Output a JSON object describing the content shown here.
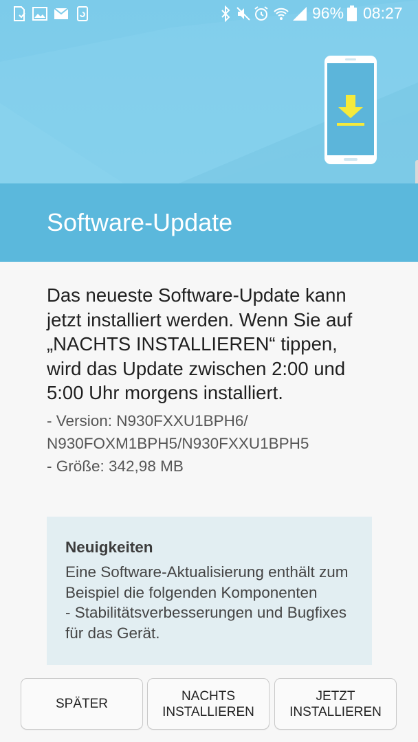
{
  "status_bar": {
    "left_icons": [
      "sim-card-icon",
      "gallery-icon",
      "email-icon",
      "recycle-icon"
    ],
    "right_icons": [
      "bluetooth-icon",
      "mute-icon",
      "alarm-icon",
      "wifi-icon",
      "signal-icon",
      "battery-icon"
    ],
    "battery_percent": "96%",
    "time": "08:27"
  },
  "header": {
    "illustration": "phone-download-icon",
    "accent_color": "#f5ea3b",
    "band_color": "#5bb8dc",
    "title": "Software-Update"
  },
  "content": {
    "description": "Das neueste Software-Update kann jetzt installiert werden. Wenn Sie auf „NACHTS INSTALLIEREN“ tippen, wird das Update zwischen 2:00 und 5:00 Uhr morgens installiert.",
    "version_line1": " - Version: N930FXXU1BPH6/",
    "version_line2": "N930FOXM1BPH5/N930FXXU1BPH5",
    "size_line": " - Größe: 342,98 MB"
  },
  "news": {
    "title": "Neuigkeiten",
    "body": "Eine Software-Aktualisierung enthält zum Beispiel die folgenden Komponenten\n- Stabilitätsverbesserungen und Bugfixes für das Gerät."
  },
  "buttons": {
    "later": "SPÄTER",
    "night_line1": "NACHTS",
    "night_line2": "INSTALLIEREN",
    "now_line1": "JETZT",
    "now_line2": "INSTALLIEREN"
  }
}
